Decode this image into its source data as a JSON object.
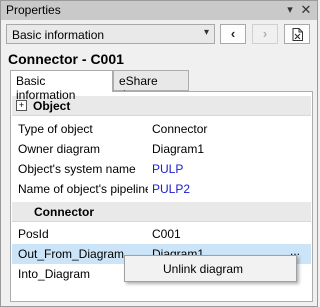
{
  "window": {
    "title": "Properties",
    "pin_glyph": "▾",
    "close_glyph": "✕"
  },
  "toolbar": {
    "combo_value": "Basic information",
    "combo_arrow": "▾",
    "back_glyph": "‹",
    "forward_glyph": "›"
  },
  "heading": "Connector - C001",
  "tabs": [
    {
      "label": "Basic information",
      "active": true
    },
    {
      "label": "eShare data",
      "active": false
    }
  ],
  "groups": [
    {
      "title": "Object",
      "expander": "+",
      "rows": [
        {
          "name": "Type of object",
          "value": "Connector"
        },
        {
          "name": "Owner diagram",
          "value": "Diagram1"
        },
        {
          "name": "Object's system name",
          "value": "PULP"
        },
        {
          "name": "Name of object's pipeline",
          "value": "PULP2"
        }
      ]
    },
    {
      "title": "Connector",
      "rows": [
        {
          "name": "PosId",
          "value": "C001"
        },
        {
          "name": "Out_From_Diagram",
          "value": "Diagram1",
          "extra": "..."
        },
        {
          "name": "Into_Diagram",
          "value": ""
        }
      ]
    }
  ],
  "context_menu": {
    "items": [
      "Unlink diagram"
    ]
  },
  "colors": {
    "link": "#1a1ad0",
    "selection": "#cce4f7",
    "titlebar": "#c9c9c9"
  }
}
